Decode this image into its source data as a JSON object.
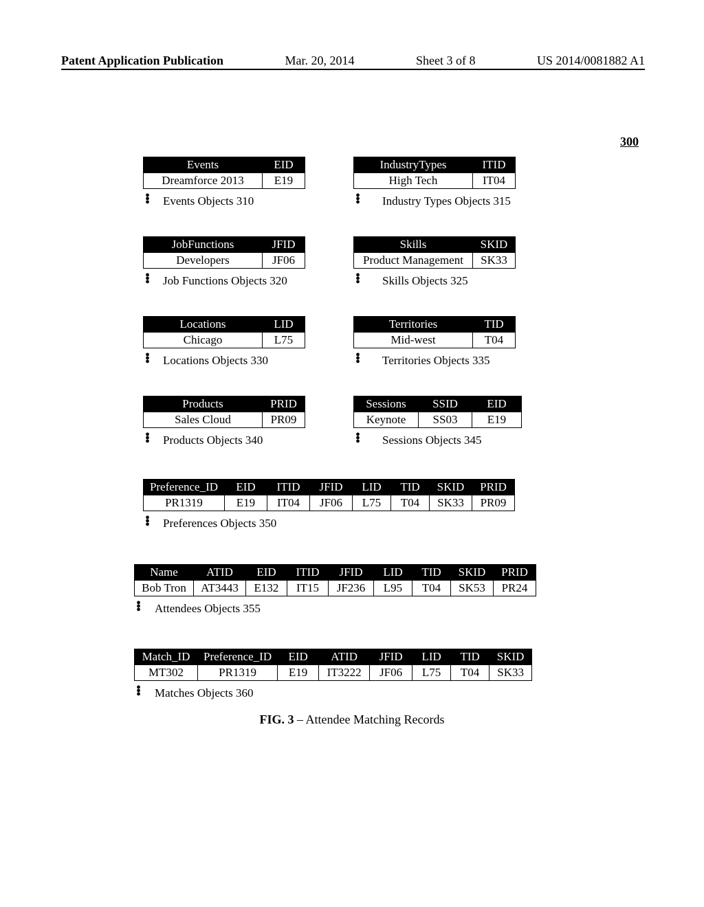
{
  "header": {
    "publication": "Patent Application Publication",
    "date": "Mar. 20, 2014",
    "sheet": "Sheet 3 of 8",
    "docnum": "US 2014/0081882 A1"
  },
  "figure_number": "300",
  "events": {
    "h1": "Events",
    "h2": "EID",
    "r1c1": "Dreamforce 2013",
    "r1c2": "E19",
    "caption": "Events Objects 310"
  },
  "industry": {
    "h1": "IndustryTypes",
    "h2": "ITID",
    "r1c1": "High Tech",
    "r1c2": "IT04",
    "caption": "Industry Types Objects 315"
  },
  "jobfunc": {
    "h1": "JobFunctions",
    "h2": "JFID",
    "r1c1": "Developers",
    "r1c2": "JF06",
    "caption": "Job Functions Objects 320"
  },
  "skills": {
    "h1": "Skills",
    "h2": "SKID",
    "r1c1": "Product Management",
    "r1c2": "SK33",
    "caption": "Skills Objects 325"
  },
  "locations": {
    "h1": "Locations",
    "h2": "LID",
    "r1c1": "Chicago",
    "r1c2": "L75",
    "caption": "Locations Objects 330"
  },
  "territories": {
    "h1": "Territories",
    "h2": "TID",
    "r1c1": "Mid-west",
    "r1c2": "T04",
    "caption": "Territories Objects 335"
  },
  "products": {
    "h1": "Products",
    "h2": "PRID",
    "r1c1": "Sales Cloud",
    "r1c2": "PR09",
    "caption": "Products Objects 340"
  },
  "sessions": {
    "h1": "Sessions",
    "h2": "SSID",
    "h3": "EID",
    "r1c1": "Keynote",
    "r1c2": "SS03",
    "r1c3": "E19",
    "caption": "Sessions Objects 345"
  },
  "preferences": {
    "h": [
      "Preference_ID",
      "EID",
      "ITID",
      "JFID",
      "LID",
      "TID",
      "SKID",
      "PRID"
    ],
    "r": [
      "PR1319",
      "E19",
      "IT04",
      "JF06",
      "L75",
      "T04",
      "SK33",
      "PR09"
    ],
    "caption": "Preferences Objects 350"
  },
  "attendees": {
    "h": [
      "Name",
      "ATID",
      "EID",
      "ITID",
      "JFID",
      "LID",
      "TID",
      "SKID",
      "PRID"
    ],
    "r": [
      "Bob Tron",
      "AT3443",
      "E132",
      "IT15",
      "JF236",
      "L95",
      "T04",
      "SK53",
      "PR24"
    ],
    "caption": "Attendees Objects 355"
  },
  "matches": {
    "h": [
      "Match_ID",
      "Preference_ID",
      "EID",
      "ATID",
      "JFID",
      "LID",
      "TID",
      "SKID"
    ],
    "r": [
      "MT302",
      "PR1319",
      "E19",
      "IT3222",
      "JF06",
      "L75",
      "T04",
      "SK33"
    ],
    "caption": "Matches Objects 360"
  },
  "figtitle_bold": "FIG. 3",
  "figtitle_rest": " – Attendee Matching Records"
}
